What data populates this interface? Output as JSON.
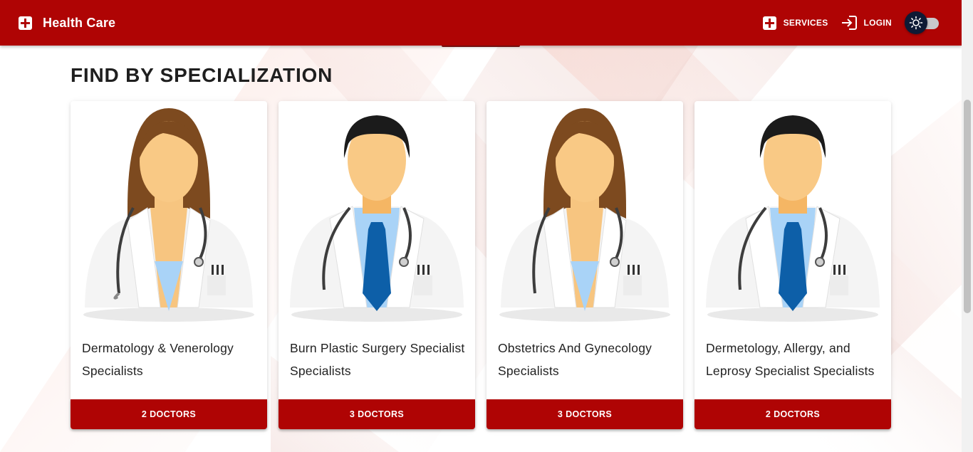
{
  "appbar": {
    "brand_title": "Health Care",
    "brand_icon": "medical-cross-icon",
    "nav": [
      {
        "label": "SERVICES",
        "icon": "medical-cross-icon"
      },
      {
        "label": "LOGIN",
        "icon": "login-icon"
      }
    ],
    "theme_toggle": {
      "icon": "sun-icon",
      "state": "off"
    }
  },
  "section": {
    "title": "FIND BY SPECIALIZATION"
  },
  "cards": [
    {
      "name": "Dermatology & Venerology Specialists",
      "button": "2 DOCTORS",
      "avatar": "female-doctor-avatar"
    },
    {
      "name": "Burn Plastic Surgery Specialist Specialists",
      "button": "3 DOCTORS",
      "avatar": "male-doctor-avatar"
    },
    {
      "name": "Obstetrics And Gynecology Specialists",
      "button": "3 DOCTORS",
      "avatar": "female-doctor-avatar"
    },
    {
      "name": "Dermetology, Allergy, and Leprosy Specialist Specialists",
      "button": "2 DOCTORS",
      "avatar": "male-doctor-avatar"
    }
  ],
  "colors": {
    "brand": "#af0404",
    "toggle_knob": "#0e1a35",
    "text": "#1f1f1f"
  }
}
